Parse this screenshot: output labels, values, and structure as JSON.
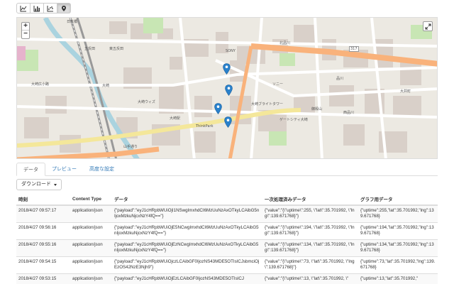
{
  "toolbar": {
    "buttons": [
      {
        "icon": "line-chart-icon",
        "active": false
      },
      {
        "icon": "bar-chart-icon",
        "active": false
      },
      {
        "icon": "scatter-chart-icon",
        "active": false
      },
      {
        "icon": "map-pin-icon",
        "active": true
      }
    ]
  },
  "map": {
    "zoom_in": "+",
    "zoom_out": "−",
    "labels": [
      "日本橋",
      "大崎",
      "大崎ウィズ",
      "ThinkPark",
      "大崎駅",
      "品川",
      "SONY",
      "大井町",
      "五反田",
      "大崎広小路",
      "東五反田",
      "ゲートシティ大崎",
      "ソニー",
      "西品川",
      "北品川",
      "御殿山",
      "大崎ブライトタワー",
      "山手通り",
      "317"
    ]
  },
  "tabs": [
    {
      "label": "データ",
      "active": true
    },
    {
      "label": "プレビュー",
      "active": false
    },
    {
      "label": "高度な設定",
      "active": false
    }
  ],
  "download_label": "ダウンロード",
  "table": {
    "headers": [
      "時刻",
      "Content Type",
      "データ",
      "一次処理済みデータ",
      "グラフ用データ"
    ],
    "rows": [
      [
        "2018/4/27 09:57:17",
        "application/json",
        "{\"payload\":\"eyJ1cHRpbWUiOjI1NSwgImxhdCI6MzUuNzAxOTkyLCAibG5nIjoxMzkuNjcxNzY4fQ==\"}",
        "{\"value\":\"{\\\"uptime\\\":255, \\\"lat\\\":35.701992, \\\"lng\\\":139.671768}\"}",
        "{\"uptime\":255,\"lat\":35.701992,\"lng\":139.671768}"
      ],
      [
        "2018/4/27 09:56:16",
        "application/json",
        "{\"payload\":\"eyJ1cHRpbWUiOjE5NCwgImxhdCI6MzUuNzAxOTkyLCAibG5nIjoxMzkuNjcxNzY4fQ==\"}",
        "{\"value\":\"{\\\"uptime\\\":194, \\\"lat\\\":35.701992, \\\"lng\\\":139.671768}\"}",
        "{\"uptime\":194,\"lat\":35.701992,\"lng\":139.671768}"
      ],
      [
        "2018/4/27 09:55:16",
        "application/json",
        "{\"payload\":\"eyJ1cHRpbWUiOjEzNCwgImxhdCI6MzUuNzAxOTkyLCAibG5nIjoxMzkuNjcxNzY4fQ==\"}",
        "{\"value\":\"{\\\"uptime\\\":134, \\\"lat\\\":35.701992, \\\"lng\\\":139.671768}\"}",
        "{\"uptime\":134,\"lat\":35.701992,\"lng\":139.671768}"
      ],
      [
        "2018/4/27 09:54:15",
        "application/json",
        "{\"payload\":\"eyJ1cHRpbWUiOjczLCAibGF0IjozNS43MDE5OTIsICJsbmciOjEzOS42NzE3Njh9\"}",
        "{\"value\":\"{\\\"uptime\\\":73, \\\"lat\\\":35.701992, \\\"lng\\\":139.671768}\"}",
        "{\"uptime\":73,\"lat\":35.701992,\"lng\":139.671768}"
      ],
      [
        "2018/4/27 09:53:15",
        "application/json",
        "{\"payload\":\"eyJ1cHRpbWUiOjEzLCAibGF0IjozNS43MDE5OTIsICJ",
        "{\"value\":\"{\\\"uptime\\\":13, \\\"lat\\\":35.701992, \\\"",
        "{\"uptime\":13,\"lat\":35.701992,\""
      ]
    ]
  },
  "colors": {
    "accent": "#337ab7",
    "marker": "#2a81cb",
    "road_major": "#f9b27b",
    "road_yellow": "#f4e79a",
    "water": "#aad3df",
    "park": "#c8e6b4",
    "building": "#d9d0c9"
  }
}
